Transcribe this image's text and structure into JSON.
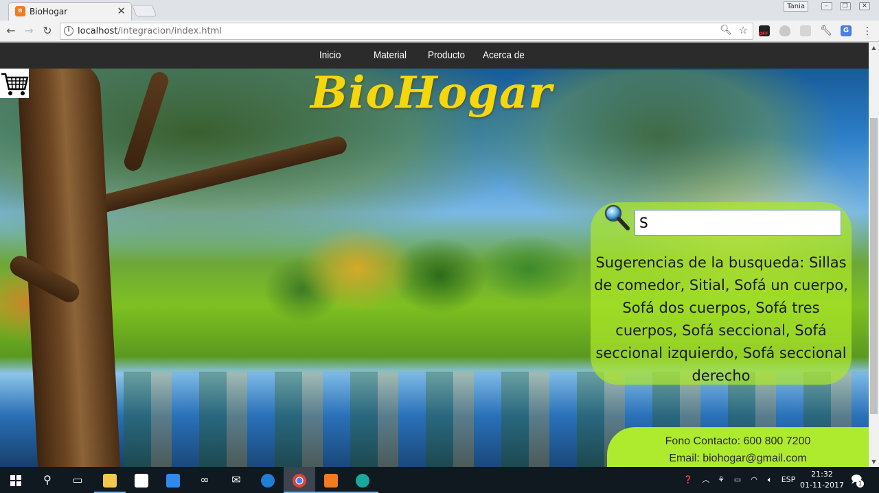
{
  "browser": {
    "tab_title": "BioHogar",
    "tab_favicon": "xampp-icon",
    "tab_close": "✕",
    "user_name": "Tania",
    "url_host": "localhost",
    "url_path": "/integracion/index.html"
  },
  "nav": {
    "items": [
      "Inicio",
      "Material",
      "Producto",
      "Acerca de"
    ]
  },
  "site": {
    "title": "BioHogar",
    "cart_icon": "shopping-cart-icon"
  },
  "search": {
    "value": "S",
    "suggestions": "Sugerencias de la busqueda: Sillas de comedor, Sitial, Sofá un cuerpo, Sofá dos cuerpos, Sofá tres cuerpos, Sofá seccional, Sofá seccional izquierdo, Sofá seccional derecho"
  },
  "contact": {
    "phone": "Fono Contacto: 600 800 7200",
    "email": "Email: biohogar@gmail.com"
  },
  "taskbar": {
    "language": "ESP",
    "time": "21:32",
    "date": "01-11-2017",
    "notification_count": "1"
  },
  "colors": {
    "title_yellow": "#f5d70b",
    "panel_green": "#aeea2e",
    "nav_bg": "#2b2b2b"
  }
}
